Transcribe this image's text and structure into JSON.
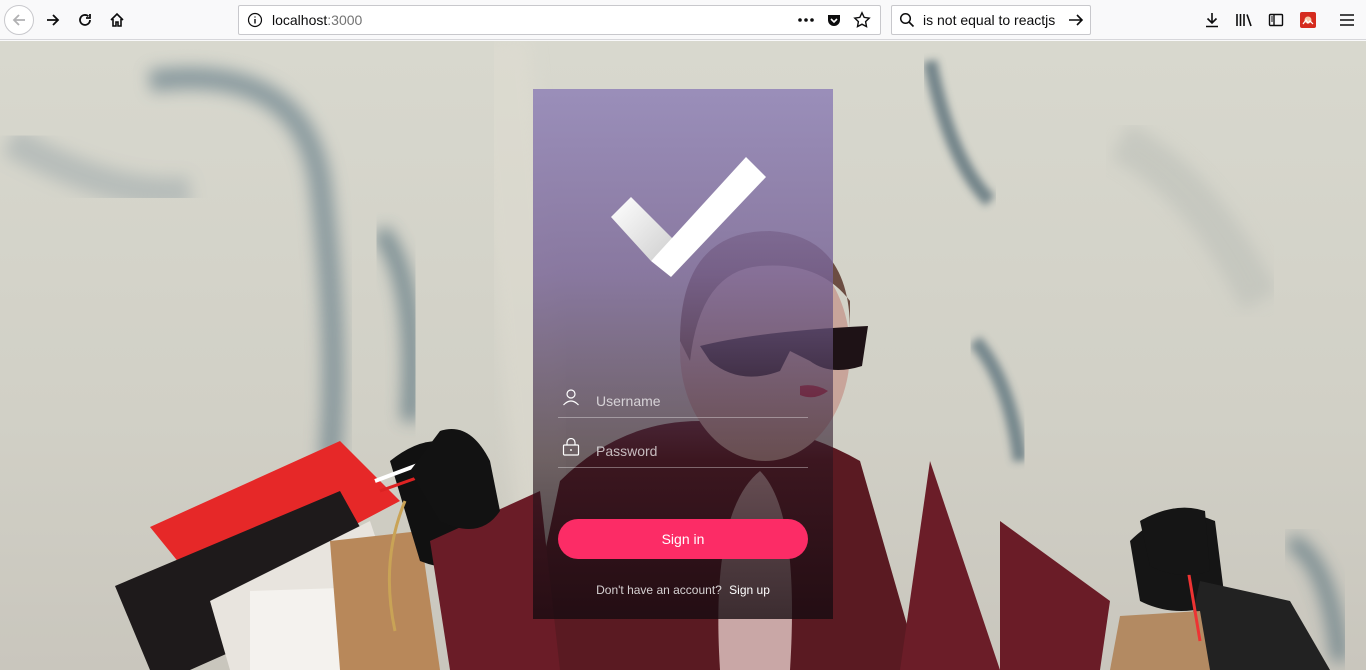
{
  "browser": {
    "url_host": "localhost",
    "url_port": ":3000",
    "search_query": "is not equal to reactjs"
  },
  "login": {
    "username_placeholder": "Username",
    "password_placeholder": "Password",
    "signin_label": "Sign in",
    "signup_question": "Don't have an account?",
    "signup_link": "Sign up"
  },
  "colors": {
    "accent": "#fc2c66",
    "card_top": "#988cb9"
  }
}
